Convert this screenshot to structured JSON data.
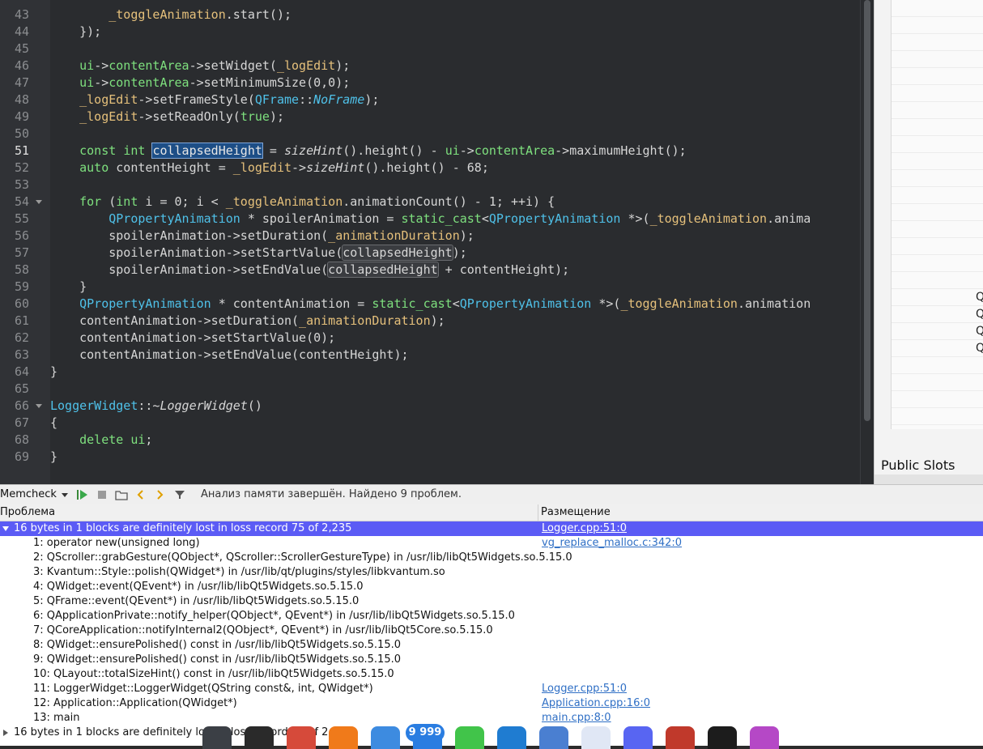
{
  "editor": {
    "lines": [
      {
        "num": "43",
        "tokens": [
          {
            "t": "        "
          },
          {
            "t": "_toggleAnimation",
            "c": "#e5c07b"
          },
          {
            "t": ".start();"
          }
        ]
      },
      {
        "num": "44",
        "tokens": [
          {
            "t": "    });"
          }
        ]
      },
      {
        "num": "45",
        "tokens": []
      },
      {
        "num": "46",
        "tokens": [
          {
            "t": "    "
          },
          {
            "t": "ui",
            "c": "#7ee07e"
          },
          {
            "t": "->"
          },
          {
            "t": "contentArea",
            "c": "#7ee07e"
          },
          {
            "t": "->setWidget("
          },
          {
            "t": "_logEdit",
            "c": "#e5c07b"
          },
          {
            "t": ");"
          }
        ]
      },
      {
        "num": "47",
        "tokens": [
          {
            "t": "    "
          },
          {
            "t": "ui",
            "c": "#7ee07e"
          },
          {
            "t": "->"
          },
          {
            "t": "contentArea",
            "c": "#7ee07e"
          },
          {
            "t": "->setMinimumSize(0,0);"
          }
        ]
      },
      {
        "num": "48",
        "tokens": [
          {
            "t": "    "
          },
          {
            "t": "_logEdit",
            "c": "#e5c07b"
          },
          {
            "t": "->setFrameStyle("
          },
          {
            "t": "QFrame",
            "c": "#4fc1e9"
          },
          {
            "t": "::"
          },
          {
            "t": "NoFrame",
            "c": "#4fc1e9",
            "i": true
          },
          {
            "t": ");"
          }
        ]
      },
      {
        "num": "49",
        "tokens": [
          {
            "t": "    "
          },
          {
            "t": "_logEdit",
            "c": "#e5c07b"
          },
          {
            "t": "->setReadOnly("
          },
          {
            "t": "true",
            "c": "#7ee07e"
          },
          {
            "t": ");"
          }
        ]
      },
      {
        "num": "50",
        "tokens": []
      },
      {
        "num": "51",
        "cur": true,
        "tokens": [
          {
            "t": "    "
          },
          {
            "t": "const",
            "c": "#7ee07e"
          },
          {
            "t": " "
          },
          {
            "t": "int",
            "c": "#7ee07e"
          },
          {
            "t": " "
          },
          {
            "t": "collapsedHeight",
            "sel": true
          },
          {
            "t": " = "
          },
          {
            "t": "sizeHint",
            "i": true
          },
          {
            "t": "().height() - "
          },
          {
            "t": "ui",
            "c": "#7ee07e"
          },
          {
            "t": "->"
          },
          {
            "t": "contentArea",
            "c": "#7ee07e"
          },
          {
            "t": "->maximumHeight();"
          }
        ]
      },
      {
        "num": "52",
        "tokens": [
          {
            "t": "    "
          },
          {
            "t": "auto",
            "c": "#7ee07e"
          },
          {
            "t": " contentHeight = "
          },
          {
            "t": "_logEdit",
            "c": "#e5c07b"
          },
          {
            "t": "->"
          },
          {
            "t": "sizeHint",
            "i": true
          },
          {
            "t": "().height() - 68;"
          }
        ]
      },
      {
        "num": "53",
        "tokens": []
      },
      {
        "num": "54",
        "fold": true,
        "tokens": [
          {
            "t": "    "
          },
          {
            "t": "for",
            "c": "#7ee07e"
          },
          {
            "t": " ("
          },
          {
            "t": "int",
            "c": "#7ee07e"
          },
          {
            "t": " i = 0; i < "
          },
          {
            "t": "_toggleAnimation",
            "c": "#e5c07b"
          },
          {
            "t": ".animationCount() - 1; ++i) {"
          }
        ]
      },
      {
        "num": "55",
        "tokens": [
          {
            "t": "        "
          },
          {
            "t": "QPropertyAnimation",
            "c": "#4fc1e9"
          },
          {
            "t": " * spoilerAnimation = "
          },
          {
            "t": "static_cast",
            "c": "#7ee07e"
          },
          {
            "t": "<"
          },
          {
            "t": "QPropertyAnimation",
            "c": "#4fc1e9"
          },
          {
            "t": " *>("
          },
          {
            "t": "_toggleAnimation",
            "c": "#e5c07b"
          },
          {
            "t": ".anima"
          }
        ]
      },
      {
        "num": "56",
        "tokens": [
          {
            "t": "        spoilerAnimation->setDuration("
          },
          {
            "t": "_animationDuration",
            "c": "#e5c07b"
          },
          {
            "t": ");"
          }
        ]
      },
      {
        "num": "57",
        "tokens": [
          {
            "t": "        spoilerAnimation->setStartValue("
          },
          {
            "t": "collapsedHeight",
            "ref": true
          },
          {
            "t": ");"
          }
        ]
      },
      {
        "num": "58",
        "tokens": [
          {
            "t": "        spoilerAnimation->setEndValue("
          },
          {
            "t": "collapsedHeight",
            "ref": true
          },
          {
            "t": " + contentHeight);"
          }
        ]
      },
      {
        "num": "59",
        "tokens": [
          {
            "t": "    }"
          }
        ]
      },
      {
        "num": "60",
        "tokens": [
          {
            "t": "    "
          },
          {
            "t": "QPropertyAnimation",
            "c": "#4fc1e9"
          },
          {
            "t": " * contentAnimation = "
          },
          {
            "t": "static_cast",
            "c": "#7ee07e"
          },
          {
            "t": "<"
          },
          {
            "t": "QPropertyAnimation",
            "c": "#4fc1e9"
          },
          {
            "t": " *>("
          },
          {
            "t": "_toggleAnimation",
            "c": "#e5c07b"
          },
          {
            "t": ".animation"
          }
        ]
      },
      {
        "num": "61",
        "tokens": [
          {
            "t": "    contentAnimation->setDuration("
          },
          {
            "t": "_animationDuration",
            "c": "#e5c07b"
          },
          {
            "t": ");"
          }
        ]
      },
      {
        "num": "62",
        "tokens": [
          {
            "t": "    contentAnimation->setStartValue(0);"
          }
        ]
      },
      {
        "num": "63",
        "tokens": [
          {
            "t": "    contentAnimation->setEndValue(contentHeight);"
          }
        ]
      },
      {
        "num": "64",
        "tokens": [
          {
            "t": "}"
          }
        ]
      },
      {
        "num": "65",
        "tokens": []
      },
      {
        "num": "66",
        "fold": true,
        "tokens": [
          {
            "t": "LoggerWidget",
            "c": "#4fc1e9"
          },
          {
            "t": "::~"
          },
          {
            "t": "LoggerWidget",
            "i": true
          },
          {
            "t": "()"
          }
        ]
      },
      {
        "num": "67",
        "tokens": [
          {
            "t": "{"
          }
        ]
      },
      {
        "num": "68",
        "tokens": [
          {
            "t": "    "
          },
          {
            "t": "delete",
            "c": "#7ee07e"
          },
          {
            "t": " "
          },
          {
            "t": "ui",
            "c": "#7ee07e"
          },
          {
            "t": ";"
          }
        ]
      },
      {
        "num": "69",
        "tokens": [
          {
            "t": "}"
          }
        ]
      }
    ]
  },
  "right_panel": {
    "partial_items": [
      "Q",
      "Q",
      "Q",
      "Q"
    ],
    "section_label": "Public Slots"
  },
  "memcheck": {
    "tool_label": "Memcheck",
    "status": "Анализ памяти завершён. Найдено 9 проблем.",
    "columns": {
      "problem": "Проблема",
      "location": "Размещение"
    },
    "rows": [
      {
        "indent": 0,
        "expander": "open",
        "selected": true,
        "desc": "16 bytes in 1 blocks are definitely lost in loss record 75 of 2,235",
        "loc": "Logger.cpp:51:0"
      },
      {
        "indent": 1,
        "desc": "1: operator new(unsigned long)",
        "loc": "vg_replace_malloc.c:342:0"
      },
      {
        "indent": 1,
        "desc": "2: QScroller::grabGesture(QObject*, QScroller::ScrollerGestureType) in /usr/lib/libQt5Widgets.so.5.15.0",
        "loc": ""
      },
      {
        "indent": 1,
        "desc": "3: Kvantum::Style::polish(QWidget*) in /usr/lib/qt/plugins/styles/libkvantum.so",
        "loc": ""
      },
      {
        "indent": 1,
        "desc": "4: QWidget::event(QEvent*) in /usr/lib/libQt5Widgets.so.5.15.0",
        "loc": ""
      },
      {
        "indent": 1,
        "desc": "5: QFrame::event(QEvent*) in /usr/lib/libQt5Widgets.so.5.15.0",
        "loc": ""
      },
      {
        "indent": 1,
        "desc": "6: QApplicationPrivate::notify_helper(QObject*, QEvent*) in /usr/lib/libQt5Widgets.so.5.15.0",
        "loc": ""
      },
      {
        "indent": 1,
        "desc": "7: QCoreApplication::notifyInternal2(QObject*, QEvent*) in /usr/lib/libQt5Core.so.5.15.0",
        "loc": ""
      },
      {
        "indent": 1,
        "desc": "8: QWidget::ensurePolished() const in /usr/lib/libQt5Widgets.so.5.15.0",
        "loc": ""
      },
      {
        "indent": 1,
        "desc": "9: QWidget::ensurePolished() const in /usr/lib/libQt5Widgets.so.5.15.0",
        "loc": ""
      },
      {
        "indent": 1,
        "desc": "10: QLayout::totalSizeHint() const in /usr/lib/libQt5Widgets.so.5.15.0",
        "loc": ""
      },
      {
        "indent": 1,
        "desc": "11: LoggerWidget::LoggerWidget(QString const&, int, QWidget*)",
        "loc": "Logger.cpp:51:0"
      },
      {
        "indent": 1,
        "desc": "12: Application::Application(QWidget*)",
        "loc": "Application.cpp:16:0"
      },
      {
        "indent": 1,
        "desc": "13: main",
        "loc": "main.cpp:8:0"
      },
      {
        "indent": 0,
        "expander": "closed",
        "desc": "16 bytes in 1 blocks are definitely lost in loss record 76 of 2,235",
        "loc": ""
      }
    ]
  },
  "dock": {
    "badge": "9 999",
    "icons": [
      "terminal-icon",
      "volume-icon",
      "chrome-icon",
      "firefox-icon",
      "files-icon",
      "telegram-icon",
      "qt-creator-icon",
      "vscode-icon",
      "app-icon",
      "store-icon",
      "discord-icon",
      "notes-icon",
      "vpn-icon",
      "screenshot-icon"
    ]
  },
  "colors": {
    "editor_bg": "#2a2c2f",
    "selection": "#5b5bf5",
    "keyword": "#7ee07e",
    "type": "#4fc1e9",
    "member": "#e5c07b"
  }
}
